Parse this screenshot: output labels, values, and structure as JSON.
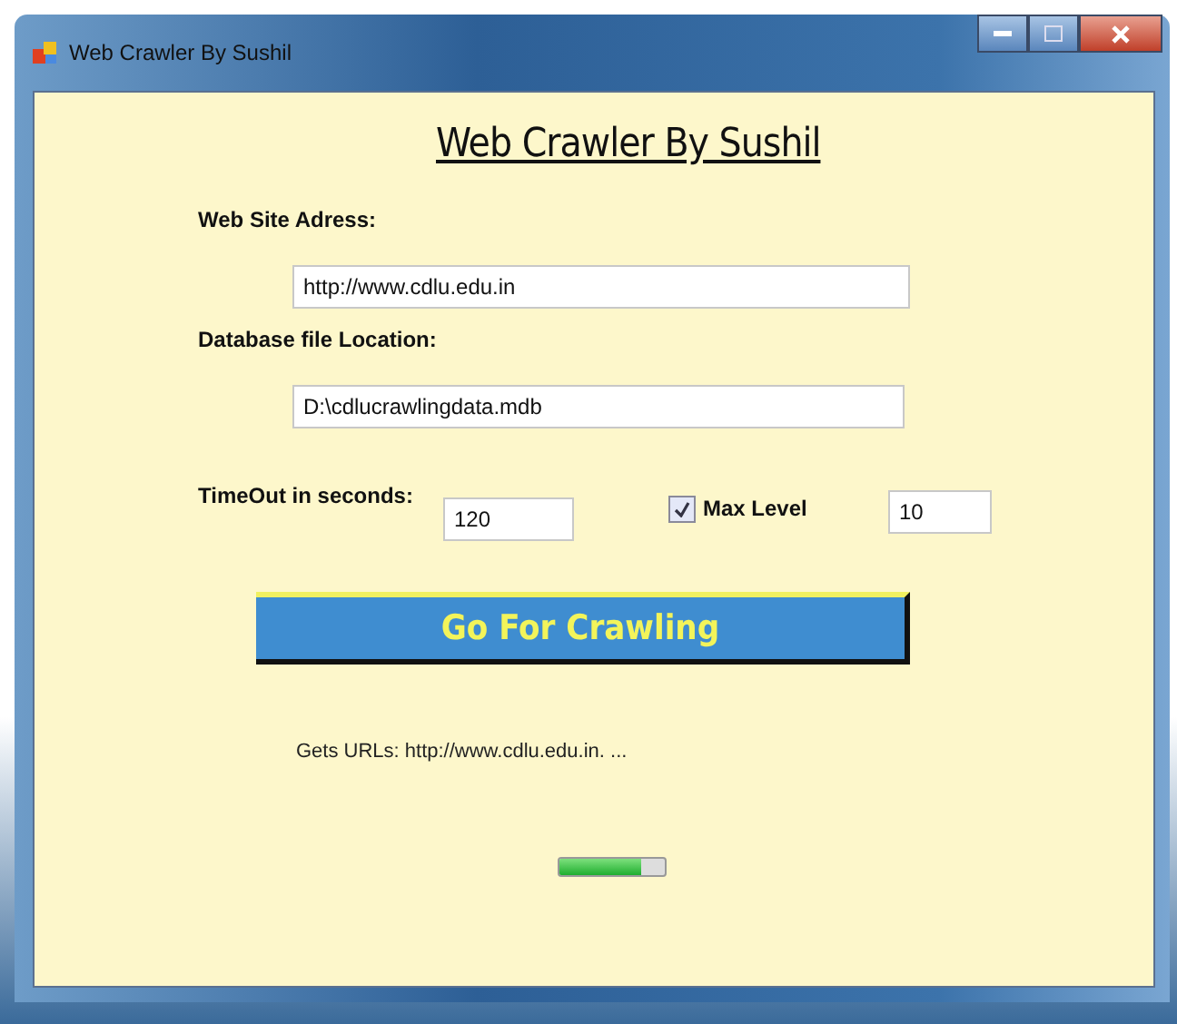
{
  "window": {
    "title": "Web Crawler By Sushil"
  },
  "heading": "Web Crawler By Sushil",
  "website": {
    "label": "Web Site Adress:",
    "value": "http://www.cdlu.edu.in"
  },
  "database": {
    "label": "Database file Location:",
    "value": "D:\\cdlucrawlingdata.mdb"
  },
  "timeout": {
    "label": "TimeOut in seconds:",
    "value": "120"
  },
  "max_level": {
    "label": "Max Level",
    "checked": true,
    "value": "10"
  },
  "crawl_button": "Go For Crawling",
  "status": "Gets URLs: http://www.cdlu.edu.in. ...",
  "progress": {
    "level": 0.78
  }
}
